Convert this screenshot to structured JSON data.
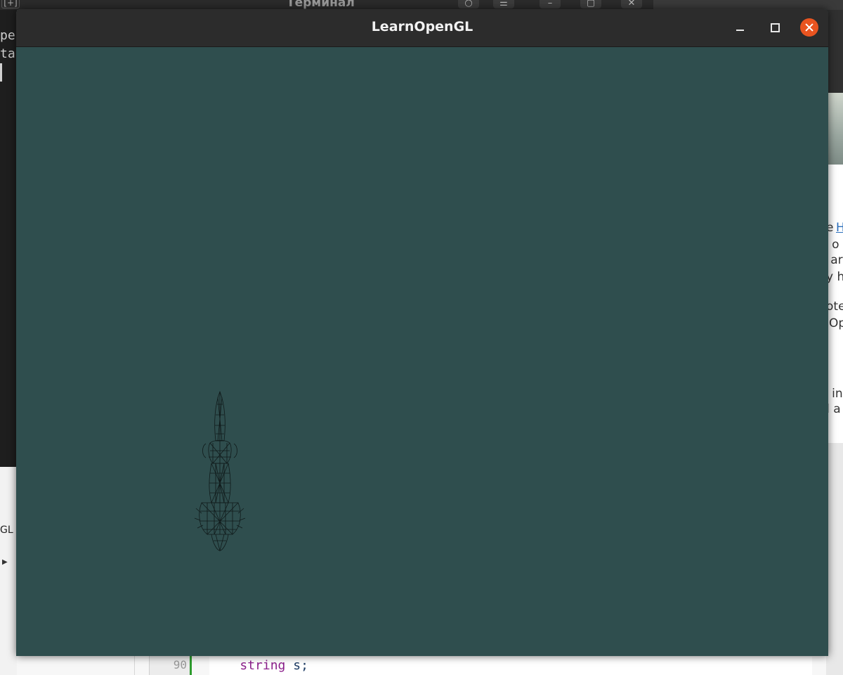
{
  "window": {
    "title": "LearnOpenGL",
    "clear_color": "#2f4e4e",
    "close_color": "#e95420",
    "controls": [
      "minimize-icon",
      "maximize-icon",
      "close-icon"
    ]
  },
  "terminal_behind": {
    "title": "Терминал",
    "new_tab_label": "[+]",
    "visible_lines": [
      "pe",
      "ta"
    ]
  },
  "left_pane_behind": {
    "label": "GL"
  },
  "browser_behind": {
    "fragments": [
      "e",
      "H",
      "n o",
      "s ar",
      "y h",
      "ote",
      "Op",
      "n in",
      "d a"
    ]
  },
  "editor_behind": {
    "line_number": "90",
    "code_keyword": "string",
    "code_rest": " s;",
    "marker_color": "#2e9c2e"
  }
}
